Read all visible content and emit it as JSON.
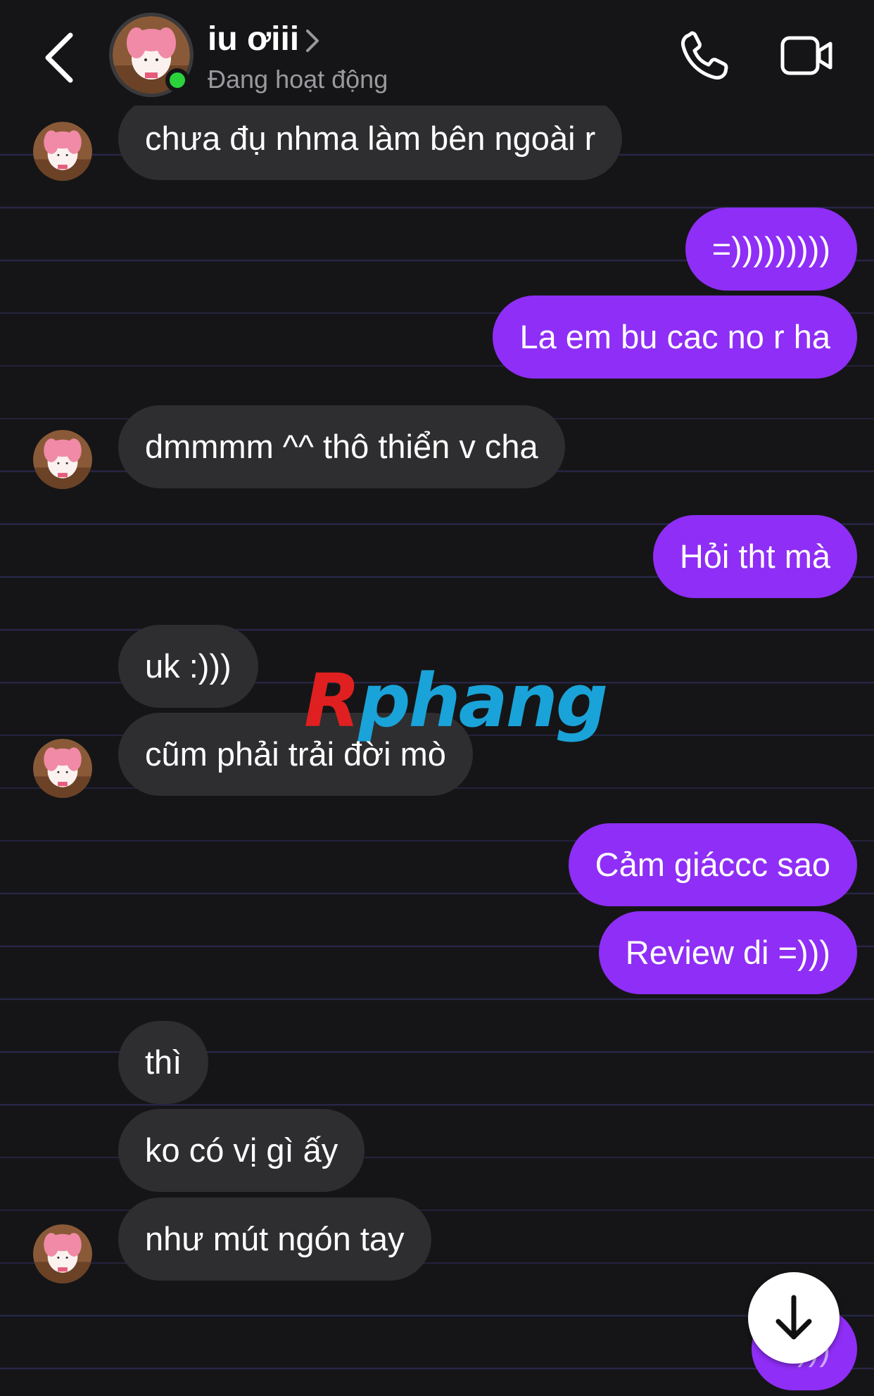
{
  "header": {
    "contact_name": "iu ơiii",
    "status": "Đang hoạt động"
  },
  "messages": [
    {
      "side": "in",
      "text": "chưa đụ nhma làm bên ngoài r"
    },
    {
      "side": "out",
      "text": "=)))))))))"
    },
    {
      "side": "out",
      "text": "La em bu cac no r ha"
    },
    {
      "side": "in",
      "text": "dmmmm ^^ thô thiển v cha"
    },
    {
      "side": "out",
      "text": "Hỏi tht mà"
    },
    {
      "side": "in",
      "text": "uk :)))"
    },
    {
      "side": "in",
      "text": "cũm phải trải đời mò"
    },
    {
      "side": "out",
      "text": "Cảm giáccc sao"
    },
    {
      "side": "out",
      "text": "Review di =)))"
    },
    {
      "side": "in",
      "text": "thì"
    },
    {
      "side": "in",
      "text": "ko có vị gì ấy"
    },
    {
      "side": "in",
      "text": "như mút ngón tay"
    },
    {
      "side": "out",
      "text": "=)))"
    }
  ],
  "watermark": {
    "r": "R",
    "rest": "phang"
  },
  "colors": {
    "background": "#151517",
    "incoming_bubble": "#2e2e30",
    "outgoing_bubble": "#8f2ef6",
    "online": "#2ad23c"
  },
  "icons": [
    "back-chevron-icon",
    "phone-icon",
    "video-camera-icon",
    "arrow-down-icon"
  ]
}
